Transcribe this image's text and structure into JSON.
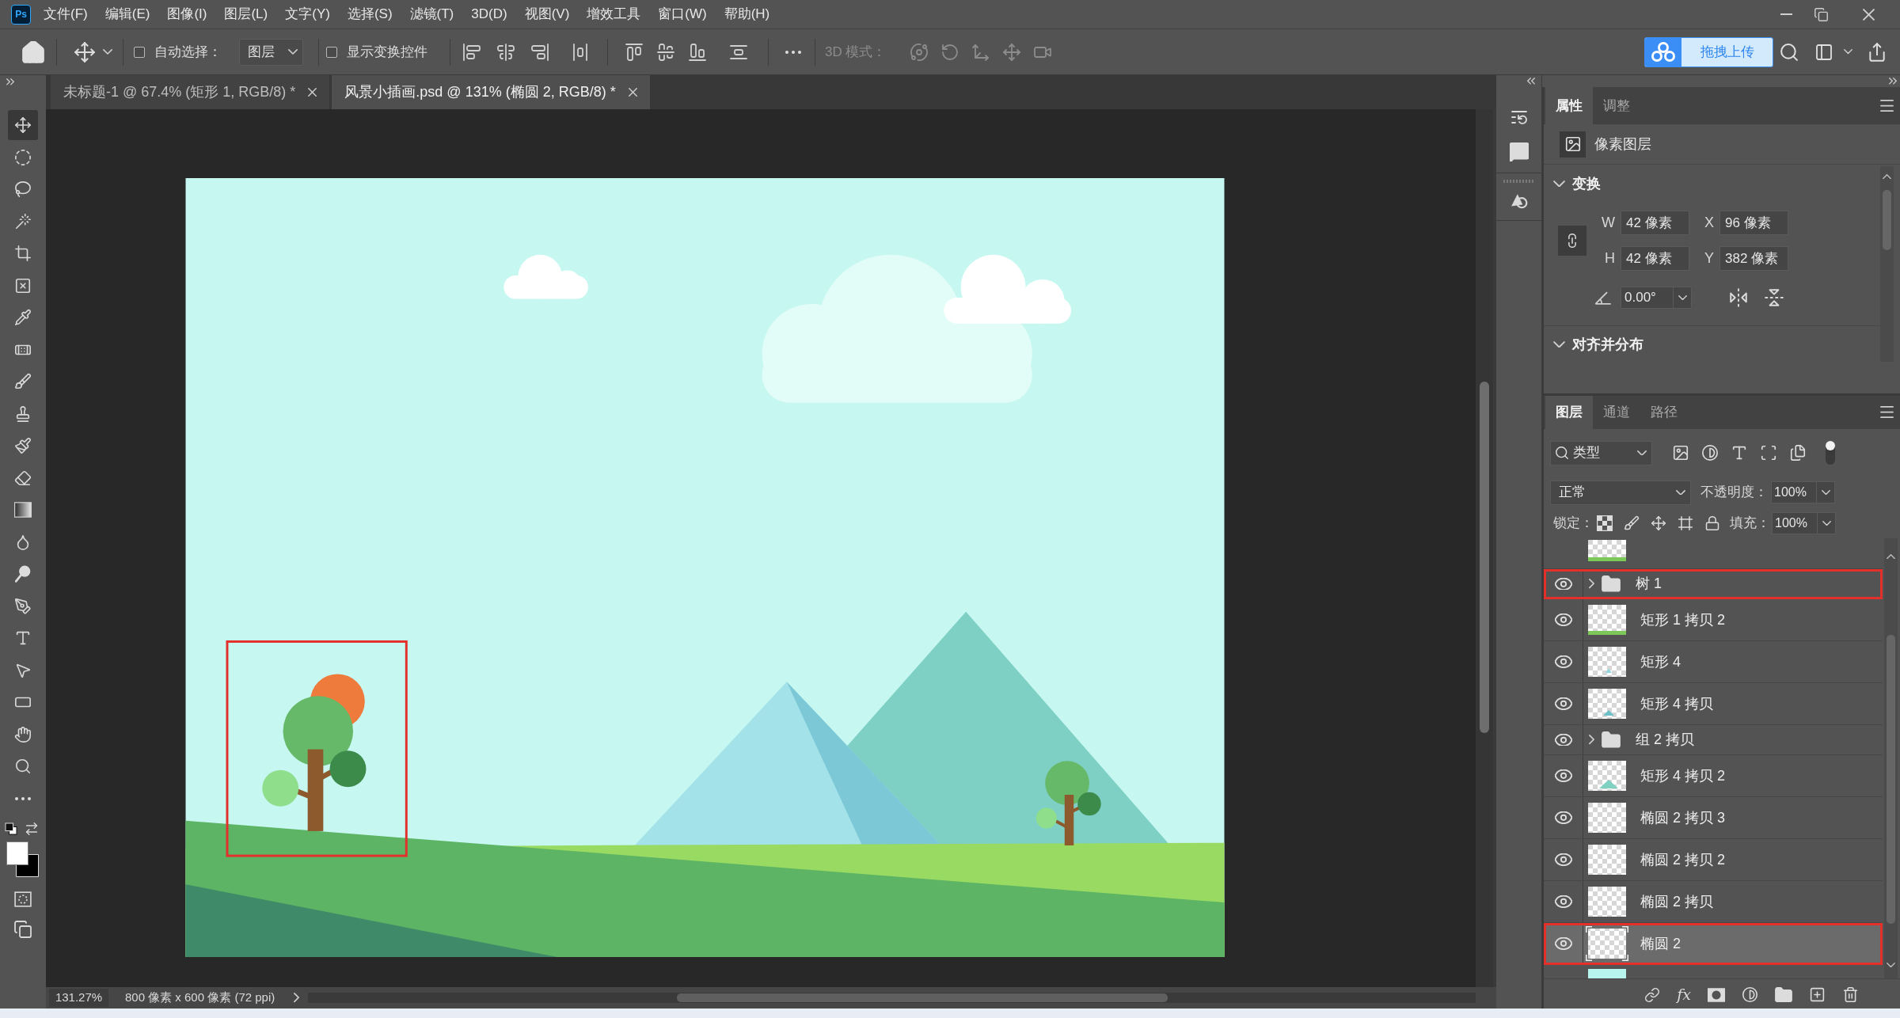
{
  "app": {
    "logo": "Ps"
  },
  "menu": [
    "文件(F)",
    "编辑(E)",
    "图像(I)",
    "图层(L)",
    "文字(Y)",
    "选择(S)",
    "滤镜(T)",
    "3D(D)",
    "视图(V)",
    "增效工具",
    "窗口(W)",
    "帮助(H)"
  ],
  "options_bar": {
    "auto_select": {
      "label": "自动选择：",
      "checked": false
    },
    "target": "图层",
    "show_transform_controls": {
      "label": "显示变换控件",
      "checked": false
    },
    "mode_3d": {
      "label": "3D 模式：",
      "disabled": true
    },
    "upload_button": "拖拽上传"
  },
  "document_tabs": [
    {
      "title": "未标题-1 @ 67.4% (矩形 1, RGB/8) *",
      "selected": false
    },
    {
      "title": "风景小插画.psd @ 131% (椭圆 2, RGB/8) *",
      "selected": true
    }
  ],
  "tools": [
    {
      "kind": "move",
      "selected": true
    },
    {
      "kind": "elliptical-marquee",
      "selected": false
    },
    {
      "kind": "lasso",
      "selected": false
    },
    {
      "kind": "quick-selection",
      "selected": false
    },
    {
      "kind": "crop",
      "selected": false
    },
    {
      "kind": "frame",
      "selected": false
    },
    {
      "kind": "eyedropper",
      "selected": false
    },
    {
      "kind": "spot-healing",
      "selected": false
    },
    {
      "kind": "brush",
      "selected": false
    },
    {
      "kind": "clone-stamp",
      "selected": false
    },
    {
      "kind": "history-brush",
      "selected": false
    },
    {
      "kind": "eraser",
      "selected": false
    },
    {
      "kind": "gradient",
      "selected": false
    },
    {
      "kind": "blur",
      "selected": false
    },
    {
      "kind": "dodge",
      "selected": false
    },
    {
      "kind": "pen",
      "selected": false
    },
    {
      "kind": "type",
      "selected": false
    },
    {
      "kind": "path-selection",
      "selected": false
    },
    {
      "kind": "rectangle",
      "selected": false
    },
    {
      "kind": "hand",
      "selected": false
    },
    {
      "kind": "zoom",
      "selected": false
    },
    {
      "kind": "edit-toolbar",
      "selected": false
    }
  ],
  "properties_panel": {
    "tabs": [
      {
        "label": "属性",
        "selected": true
      },
      {
        "label": "调整",
        "selected": false
      }
    ],
    "layer_type": "像素图层",
    "transform": {
      "title": "变换",
      "expanded": true,
      "fields": [
        {
          "label": "W",
          "value": "42 像素"
        },
        {
          "label": "X",
          "value": "96 像素"
        },
        {
          "label": "H",
          "value": "42 像素"
        },
        {
          "label": "Y",
          "value": "382 像素"
        }
      ],
      "angle": "0.00°"
    },
    "align": {
      "title": "对齐并分布",
      "expanded": true
    }
  },
  "layers_panel": {
    "tabs": [
      {
        "label": "图层",
        "selected": true
      },
      {
        "label": "通道",
        "selected": false
      },
      {
        "label": "路径",
        "selected": false
      }
    ],
    "filter": "类型",
    "filter_on": true,
    "blend_mode": "正常",
    "opacity_label": "不透明度：",
    "opacity": "100%",
    "lock_label": "锁定：",
    "fill_label": "填充：",
    "fill": "100%",
    "layers": [
      {
        "kind": "group",
        "name": "树 1",
        "visible": true,
        "expanded": false,
        "selected": false,
        "marked": true
      },
      {
        "kind": "layer",
        "name": "矩形 1 拷贝 2",
        "visible": true,
        "selected": false,
        "marked": false,
        "thumbnail": {
          "kind": "strip"
        }
      },
      {
        "kind": "layer",
        "name": "矩形 4",
        "visible": true,
        "selected": false,
        "marked": false,
        "thumbnail": {
          "kind": "small-triangle"
        }
      },
      {
        "kind": "layer",
        "name": "矩形 4 拷贝",
        "visible": true,
        "selected": false,
        "marked": false,
        "thumbnail": {
          "kind": "triangle"
        }
      },
      {
        "kind": "group",
        "name": "组 2 拷贝",
        "visible": true,
        "expanded": false,
        "selected": false,
        "marked": false
      },
      {
        "kind": "layer",
        "name": "矩形 4 拷贝 2",
        "visible": true,
        "selected": false,
        "marked": false,
        "thumbnail": {
          "kind": "large-triangle"
        }
      },
      {
        "kind": "layer",
        "name": "椭圆 2 拷贝 3",
        "visible": true,
        "selected": false,
        "marked": false,
        "thumbnail": {
          "kind": "blank"
        }
      },
      {
        "kind": "layer",
        "name": "椭圆 2 拷贝 2",
        "visible": true,
        "selected": false,
        "marked": false,
        "thumbnail": {
          "kind": "blank"
        }
      },
      {
        "kind": "layer",
        "name": "椭圆 2 拷贝",
        "visible": true,
        "selected": false,
        "marked": false,
        "thumbnail": {
          "kind": "blank"
        }
      },
      {
        "kind": "layer",
        "name": "椭圆 2",
        "visible": true,
        "selected": true,
        "marked": true,
        "thumbnail": {
          "kind": "blank"
        }
      }
    ],
    "style_button": "fx"
  },
  "status_bar": {
    "zoom": "131.27%",
    "document_size": "800 像素 x 600 像素 (72 ppi)"
  }
}
